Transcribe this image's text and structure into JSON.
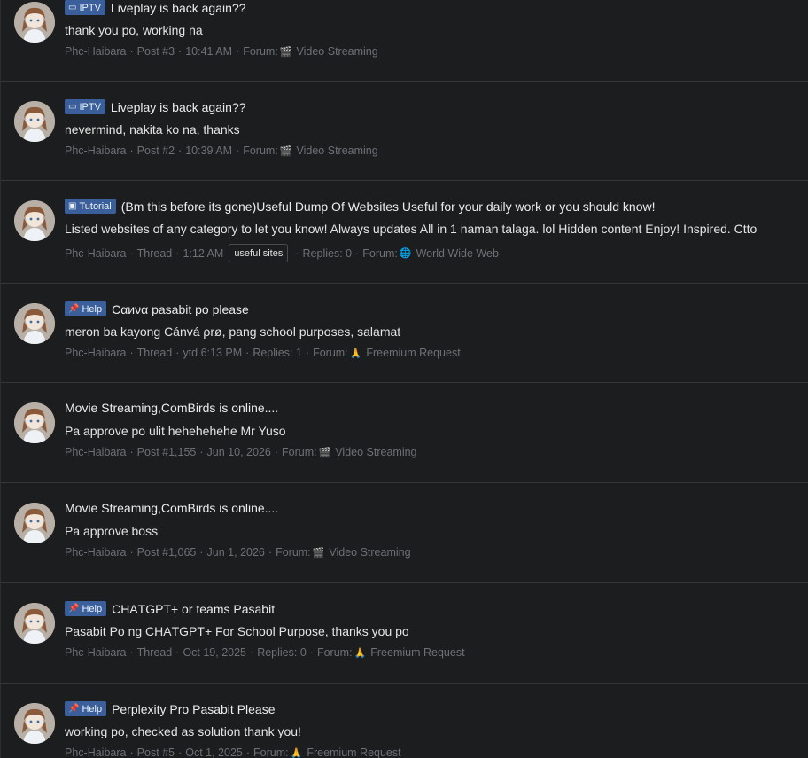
{
  "results": [
    {
      "badge": {
        "label": "IPTV",
        "icon": "tv-icon",
        "color": "#3a5f9a"
      },
      "title": "Liveplay is back again??",
      "snippet": "thank you po, working na",
      "meta": {
        "author": "Phc-Haibara",
        "type": "Post #3",
        "time": "10:41 AM",
        "forum_label": "Forum:",
        "forum_icon": "clapper-icon",
        "forum": "Video Streaming"
      }
    },
    {
      "badge": {
        "label": "IPTV",
        "icon": "tv-icon",
        "color": "#3a5f9a"
      },
      "title": "Liveplay is back again??",
      "snippet": "nevermind, nakita ko na, thanks",
      "meta": {
        "author": "Phc-Haibara",
        "type": "Post #2",
        "time": "10:39 AM",
        "forum_label": "Forum:",
        "forum_icon": "clapper-icon",
        "forum": "Video Streaming"
      }
    },
    {
      "badge": {
        "label": "Tutorial",
        "icon": "tutorial-icon",
        "color": "#3a5f9a"
      },
      "title": "(Bm this before its gone)Useful Dump Of Websites Useful for your daily work or you should know!",
      "snippet": "Listed websites of any category to let you know! Always updates All in 1 naman talaga. lol Hidden content Enjoy! Inspired. Ctto",
      "meta": {
        "author": "Phc-Haibara",
        "type": "Thread",
        "time": "1:12 AM",
        "tag": "useful sites",
        "replies": "Replies: 0",
        "forum_label": "Forum:",
        "forum_icon": "globe-icon",
        "forum": "World Wide Web"
      }
    },
    {
      "badge": {
        "label": "Help",
        "icon": "pin-icon",
        "color": "#3a5f9a"
      },
      "title": "Cαиνα pasabit po please",
      "snippet": "meron ba kayong Cánvá ρrø, pang school purposes, salamat",
      "meta": {
        "author": "Phc-Haibara",
        "type": "Thread",
        "time": "ytd 6:13 PM",
        "replies": "Replies: 1",
        "forum_label": "Forum:",
        "forum_icon": "pray-icon",
        "forum": "Freemium Request"
      }
    },
    {
      "title": "Movie Streaming,ComBirds is online....",
      "snippet": "Pa approve po ulit hehehehehe Mr Yuso",
      "meta": {
        "author": "Phc-Haibara",
        "type": "Post #1,155",
        "time": "Jun 10, 2026",
        "forum_label": "Forum:",
        "forum_icon": "clapper-icon",
        "forum": "Video Streaming"
      }
    },
    {
      "title": "Movie Streaming,ComBirds is online....",
      "snippet": "Pa approve boss",
      "meta": {
        "author": "Phc-Haibara",
        "type": "Post #1,065",
        "time": "Jun 1, 2026",
        "forum_label": "Forum:",
        "forum_icon": "clapper-icon",
        "forum": "Video Streaming"
      }
    },
    {
      "badge": {
        "label": "Help",
        "icon": "pin-icon",
        "color": "#3a5f9a"
      },
      "title": "CΗΑTGΡT+ or teams Pasabit",
      "snippet": "Pasabit Po ng CΗΑTGΡT+ For School Purpose, thanks you po",
      "meta": {
        "author": "Phc-Haibara",
        "type": "Thread",
        "time": "Oct 19, 2025",
        "replies": "Replies: 0",
        "forum_label": "Forum:",
        "forum_icon": "pray-icon",
        "forum": "Freemium Request"
      }
    },
    {
      "badge": {
        "label": "Help",
        "icon": "pin-icon",
        "color": "#3a5f9a"
      },
      "title": "Perplexity Pro Pasabit Please",
      "snippet": "working po, checked as solution thank you!",
      "meta": {
        "author": "Phc-Haibara",
        "type": "Post #5",
        "time": "Oct 1, 2025",
        "forum_label": "Forum:",
        "forum_icon": "pray-icon",
        "forum": "Freemium Request"
      }
    }
  ]
}
